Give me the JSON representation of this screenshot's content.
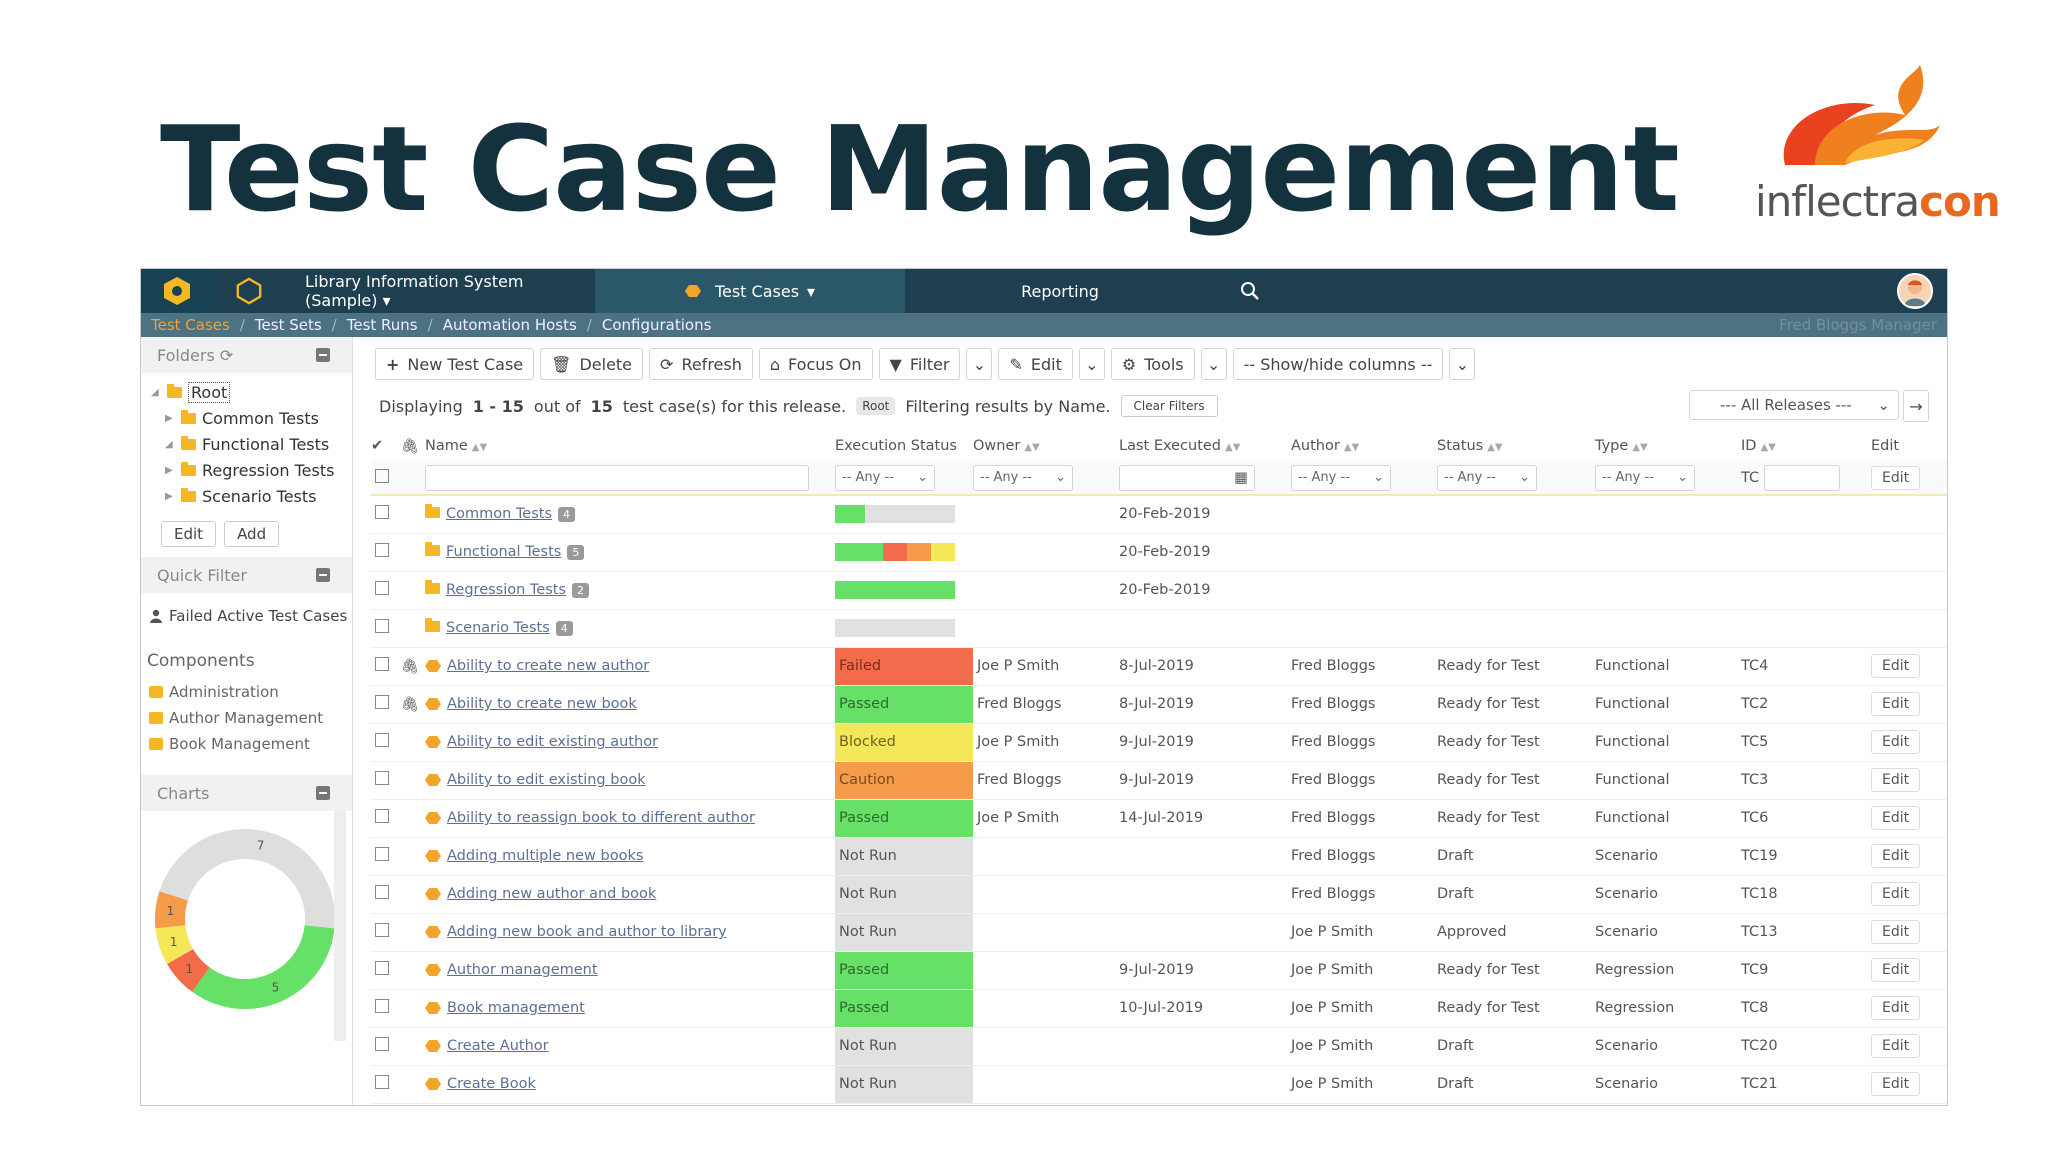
{
  "slide": {
    "title": "Test Case Management"
  },
  "brand": {
    "prefix": "inflectra",
    "suffix": "con"
  },
  "topnav": {
    "project": "Library Information System (Sample)",
    "active_tab": "Test Cases",
    "reporting": "Reporting"
  },
  "subnav": {
    "items": [
      "Test Cases",
      "Test Sets",
      "Test Runs",
      "Automation Hosts",
      "Configurations"
    ],
    "user": "Fred Bloggs  Manager"
  },
  "sidebar": {
    "folders_label": "Folders",
    "root": "Root",
    "folders": [
      "Common Tests",
      "Functional Tests",
      "Regression Tests",
      "Scenario Tests"
    ],
    "edit": "Edit",
    "add": "Add",
    "quick_filter": "Quick Filter",
    "saved_filter": "Failed Active Test Cases",
    "components_title": "Components",
    "components": [
      "Administration",
      "Author Management",
      "Book Management"
    ],
    "charts_label": "Charts",
    "chart": {
      "segments": [
        {
          "value": 7,
          "color": "#dedede"
        },
        {
          "value": 5,
          "color": "#66e066"
        },
        {
          "value": 1,
          "color": "#f26b4a"
        },
        {
          "value": 1,
          "color": "#f4e85a"
        },
        {
          "value": 1,
          "color": "#f59b4a"
        }
      ]
    }
  },
  "toolbar": {
    "new": "New Test Case",
    "delete": "Delete",
    "refresh": "Refresh",
    "focus": "Focus On",
    "filter": "Filter",
    "edit": "Edit",
    "tools": "Tools",
    "columns": "-- Show/hide columns --"
  },
  "info": {
    "displaying": "Displaying",
    "range": "1 - 15",
    "out_of": "out of",
    "total": "15",
    "suffix": "test case(s) for this release.",
    "root_badge": "Root",
    "filtering": "Filtering results by Name.",
    "clear": "Clear Filters",
    "release": "--- All Releases ---"
  },
  "columns": {
    "name": "Name",
    "exec": "Execution Status",
    "owner": "Owner",
    "last": "Last Executed",
    "author": "Author",
    "status": "Status",
    "type": "Type",
    "id": "ID",
    "edit": "Edit"
  },
  "filters": {
    "any": "-- Any --",
    "tc": "TC",
    "edit": "Edit"
  },
  "folder_rows": [
    {
      "name": "Common Tests",
      "count": "4",
      "date": "20-Feb-2019",
      "bar": [
        [
          0.25,
          "#66e066"
        ],
        [
          0.75,
          "#e1e1e1"
        ]
      ]
    },
    {
      "name": "Functional Tests",
      "count": "5",
      "date": "20-Feb-2019",
      "bar": [
        [
          0.4,
          "#66e066"
        ],
        [
          0.2,
          "#f26b4a"
        ],
        [
          0.2,
          "#f59b4a"
        ],
        [
          0.2,
          "#f4e85a"
        ]
      ]
    },
    {
      "name": "Regression Tests",
      "count": "2",
      "date": "20-Feb-2019",
      "bar": [
        [
          1.0,
          "#66e066"
        ]
      ]
    },
    {
      "name": "Scenario Tests",
      "count": "4",
      "date": "",
      "bar": [
        [
          1.0,
          "#e1e1e1"
        ]
      ]
    }
  ],
  "rows": [
    {
      "name": "Ability to create new author",
      "attach": true,
      "status": "Failed",
      "owner": "Joe P Smith",
      "last": "8-Jul-2019",
      "author": "Fred Bloggs",
      "wf": "Ready for Test",
      "type": "Functional",
      "id": "TC4"
    },
    {
      "name": "Ability to create new book",
      "attach": true,
      "status": "Passed",
      "owner": "Fred Bloggs",
      "last": "8-Jul-2019",
      "author": "Fred Bloggs",
      "wf": "Ready for Test",
      "type": "Functional",
      "id": "TC2"
    },
    {
      "name": "Ability to edit existing author",
      "attach": false,
      "status": "Blocked",
      "owner": "Joe P Smith",
      "last": "9-Jul-2019",
      "author": "Fred Bloggs",
      "wf": "Ready for Test",
      "type": "Functional",
      "id": "TC5"
    },
    {
      "name": "Ability to edit existing book",
      "attach": false,
      "status": "Caution",
      "owner": "Fred Bloggs",
      "last": "9-Jul-2019",
      "author": "Fred Bloggs",
      "wf": "Ready for Test",
      "type": "Functional",
      "id": "TC3"
    },
    {
      "name": "Ability to reassign book to different author",
      "attach": false,
      "status": "Passed",
      "owner": "Joe P Smith",
      "last": "14-Jul-2019",
      "author": "Fred Bloggs",
      "wf": "Ready for Test",
      "type": "Functional",
      "id": "TC6"
    },
    {
      "name": "Adding multiple new books",
      "attach": false,
      "status": "Not Run",
      "owner": "",
      "last": "",
      "author": "Fred Bloggs",
      "wf": "Draft",
      "type": "Scenario",
      "id": "TC19"
    },
    {
      "name": "Adding new author and book",
      "attach": false,
      "status": "Not Run",
      "owner": "",
      "last": "",
      "author": "Fred Bloggs",
      "wf": "Draft",
      "type": "Scenario",
      "id": "TC18"
    },
    {
      "name": "Adding new book and author to library",
      "attach": false,
      "status": "Not Run",
      "owner": "",
      "last": "",
      "author": "Joe P Smith",
      "wf": "Approved",
      "type": "Scenario",
      "id": "TC13"
    },
    {
      "name": "Author management",
      "attach": false,
      "status": "Passed",
      "owner": "",
      "last": "9-Jul-2019",
      "author": "Joe P Smith",
      "wf": "Ready for Test",
      "type": "Regression",
      "id": "TC9"
    },
    {
      "name": "Book management",
      "attach": false,
      "status": "Passed",
      "owner": "",
      "last": "10-Jul-2019",
      "author": "Joe P Smith",
      "wf": "Ready for Test",
      "type": "Regression",
      "id": "TC8"
    },
    {
      "name": "Create Author",
      "attach": false,
      "status": "Not Run",
      "owner": "",
      "last": "",
      "author": "Joe P Smith",
      "wf": "Draft",
      "type": "Scenario",
      "id": "TC20"
    },
    {
      "name": "Create Book",
      "attach": false,
      "status": "Not Run",
      "owner": "",
      "last": "",
      "author": "Joe P Smith",
      "wf": "Draft",
      "type": "Scenario",
      "id": "TC21"
    }
  ],
  "edit_label": "Edit"
}
